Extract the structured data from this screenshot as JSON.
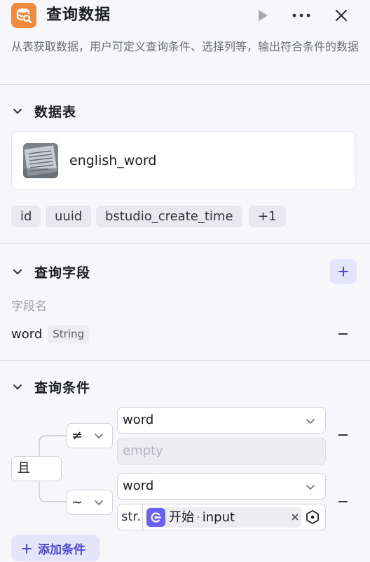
{
  "header": {
    "title": "查询数据",
    "description": "从表获取数据，用户可定义查询条件、选择列等，输出符合条件的数据",
    "icon": "database-search-icon",
    "accent": "#f08a3c"
  },
  "table_section": {
    "title": "数据表",
    "table_name": "english_word",
    "chips": [
      "id",
      "uuid",
      "bstudio_create_time",
      "+1"
    ]
  },
  "fields_section": {
    "title": "查询字段",
    "column_label": "字段名",
    "fields": [
      {
        "name": "word",
        "type": "String"
      }
    ]
  },
  "conditions_section": {
    "title": "查询条件",
    "logic": "且",
    "conditions": [
      {
        "operator": "≠",
        "field": "word",
        "value_placeholder": "empty"
      },
      {
        "operator": "∼",
        "field": "word",
        "value_type": "str.",
        "ref_node": "开始",
        "ref_var": "input"
      }
    ],
    "add_label": "添加条件"
  },
  "colors": {
    "primary": "#4d48d9",
    "primary_light": "#e4e4fb",
    "node_icon": "#6a5ff6"
  }
}
